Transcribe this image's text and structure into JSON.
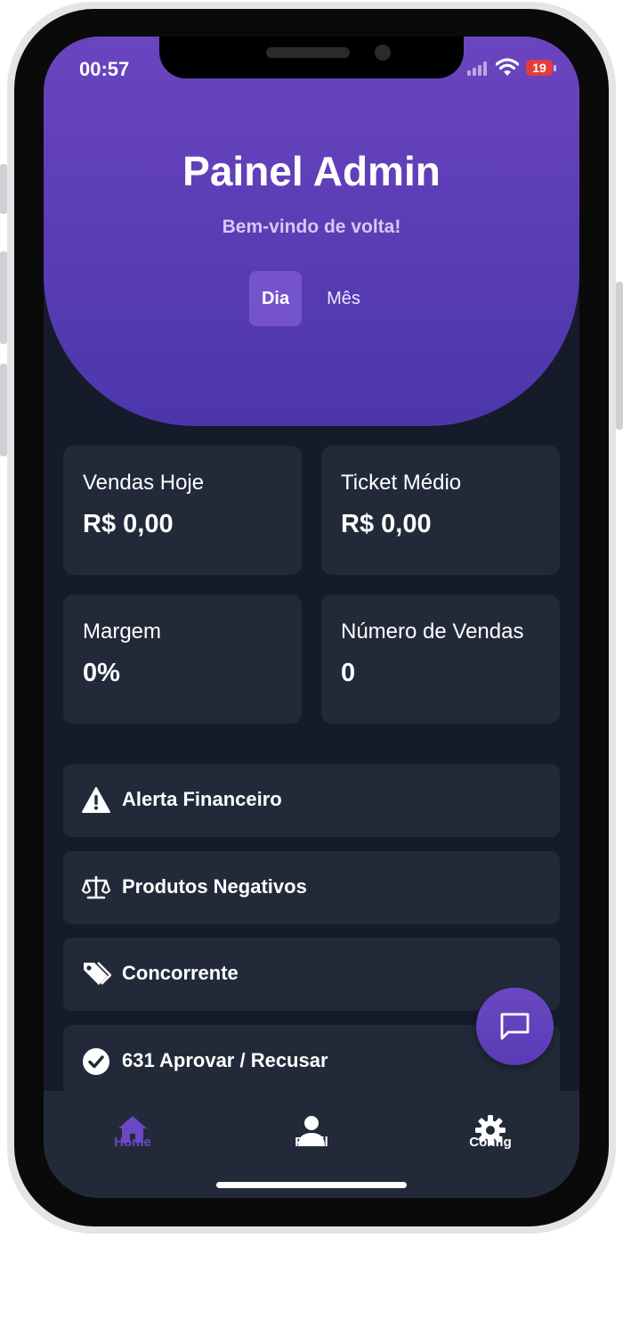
{
  "status_bar": {
    "time": "00:57",
    "battery": "19"
  },
  "header": {
    "title": "Painel Admin",
    "subtitle": "Bem-vindo de volta!"
  },
  "period_tabs": [
    {
      "label": "Dia",
      "selected": true
    },
    {
      "label": "Mês",
      "selected": false
    }
  ],
  "stats": [
    {
      "label": "Vendas Hoje",
      "value": "R$ 0,00"
    },
    {
      "label": "Ticket Médio",
      "value": "R$ 0,00"
    },
    {
      "label": "Margem",
      "value": "0%"
    },
    {
      "label": "Número de Vendas",
      "value": "0"
    }
  ],
  "actions": [
    {
      "icon": "warning-icon",
      "label": "Alerta Financeiro"
    },
    {
      "icon": "scale-icon",
      "label": "Produtos Negativos"
    },
    {
      "icon": "tags-icon",
      "label": "Concorrente"
    },
    {
      "icon": "check-circle-icon",
      "label": "631 Aprovar / Recusar"
    }
  ],
  "fab": {
    "icon": "chat-icon"
  },
  "bottom_nav": [
    {
      "icon": "home-icon",
      "label": "Home",
      "active": true
    },
    {
      "icon": "user-icon",
      "label": "Perfil",
      "active": false
    },
    {
      "icon": "gear-icon",
      "label": "Config",
      "active": false
    }
  ],
  "colors": {
    "accent": "#6a45bf",
    "active_nav": "#6b48c4",
    "background": "#151b2a",
    "card": "#222a3a",
    "battery_low": "#e53b3b"
  }
}
